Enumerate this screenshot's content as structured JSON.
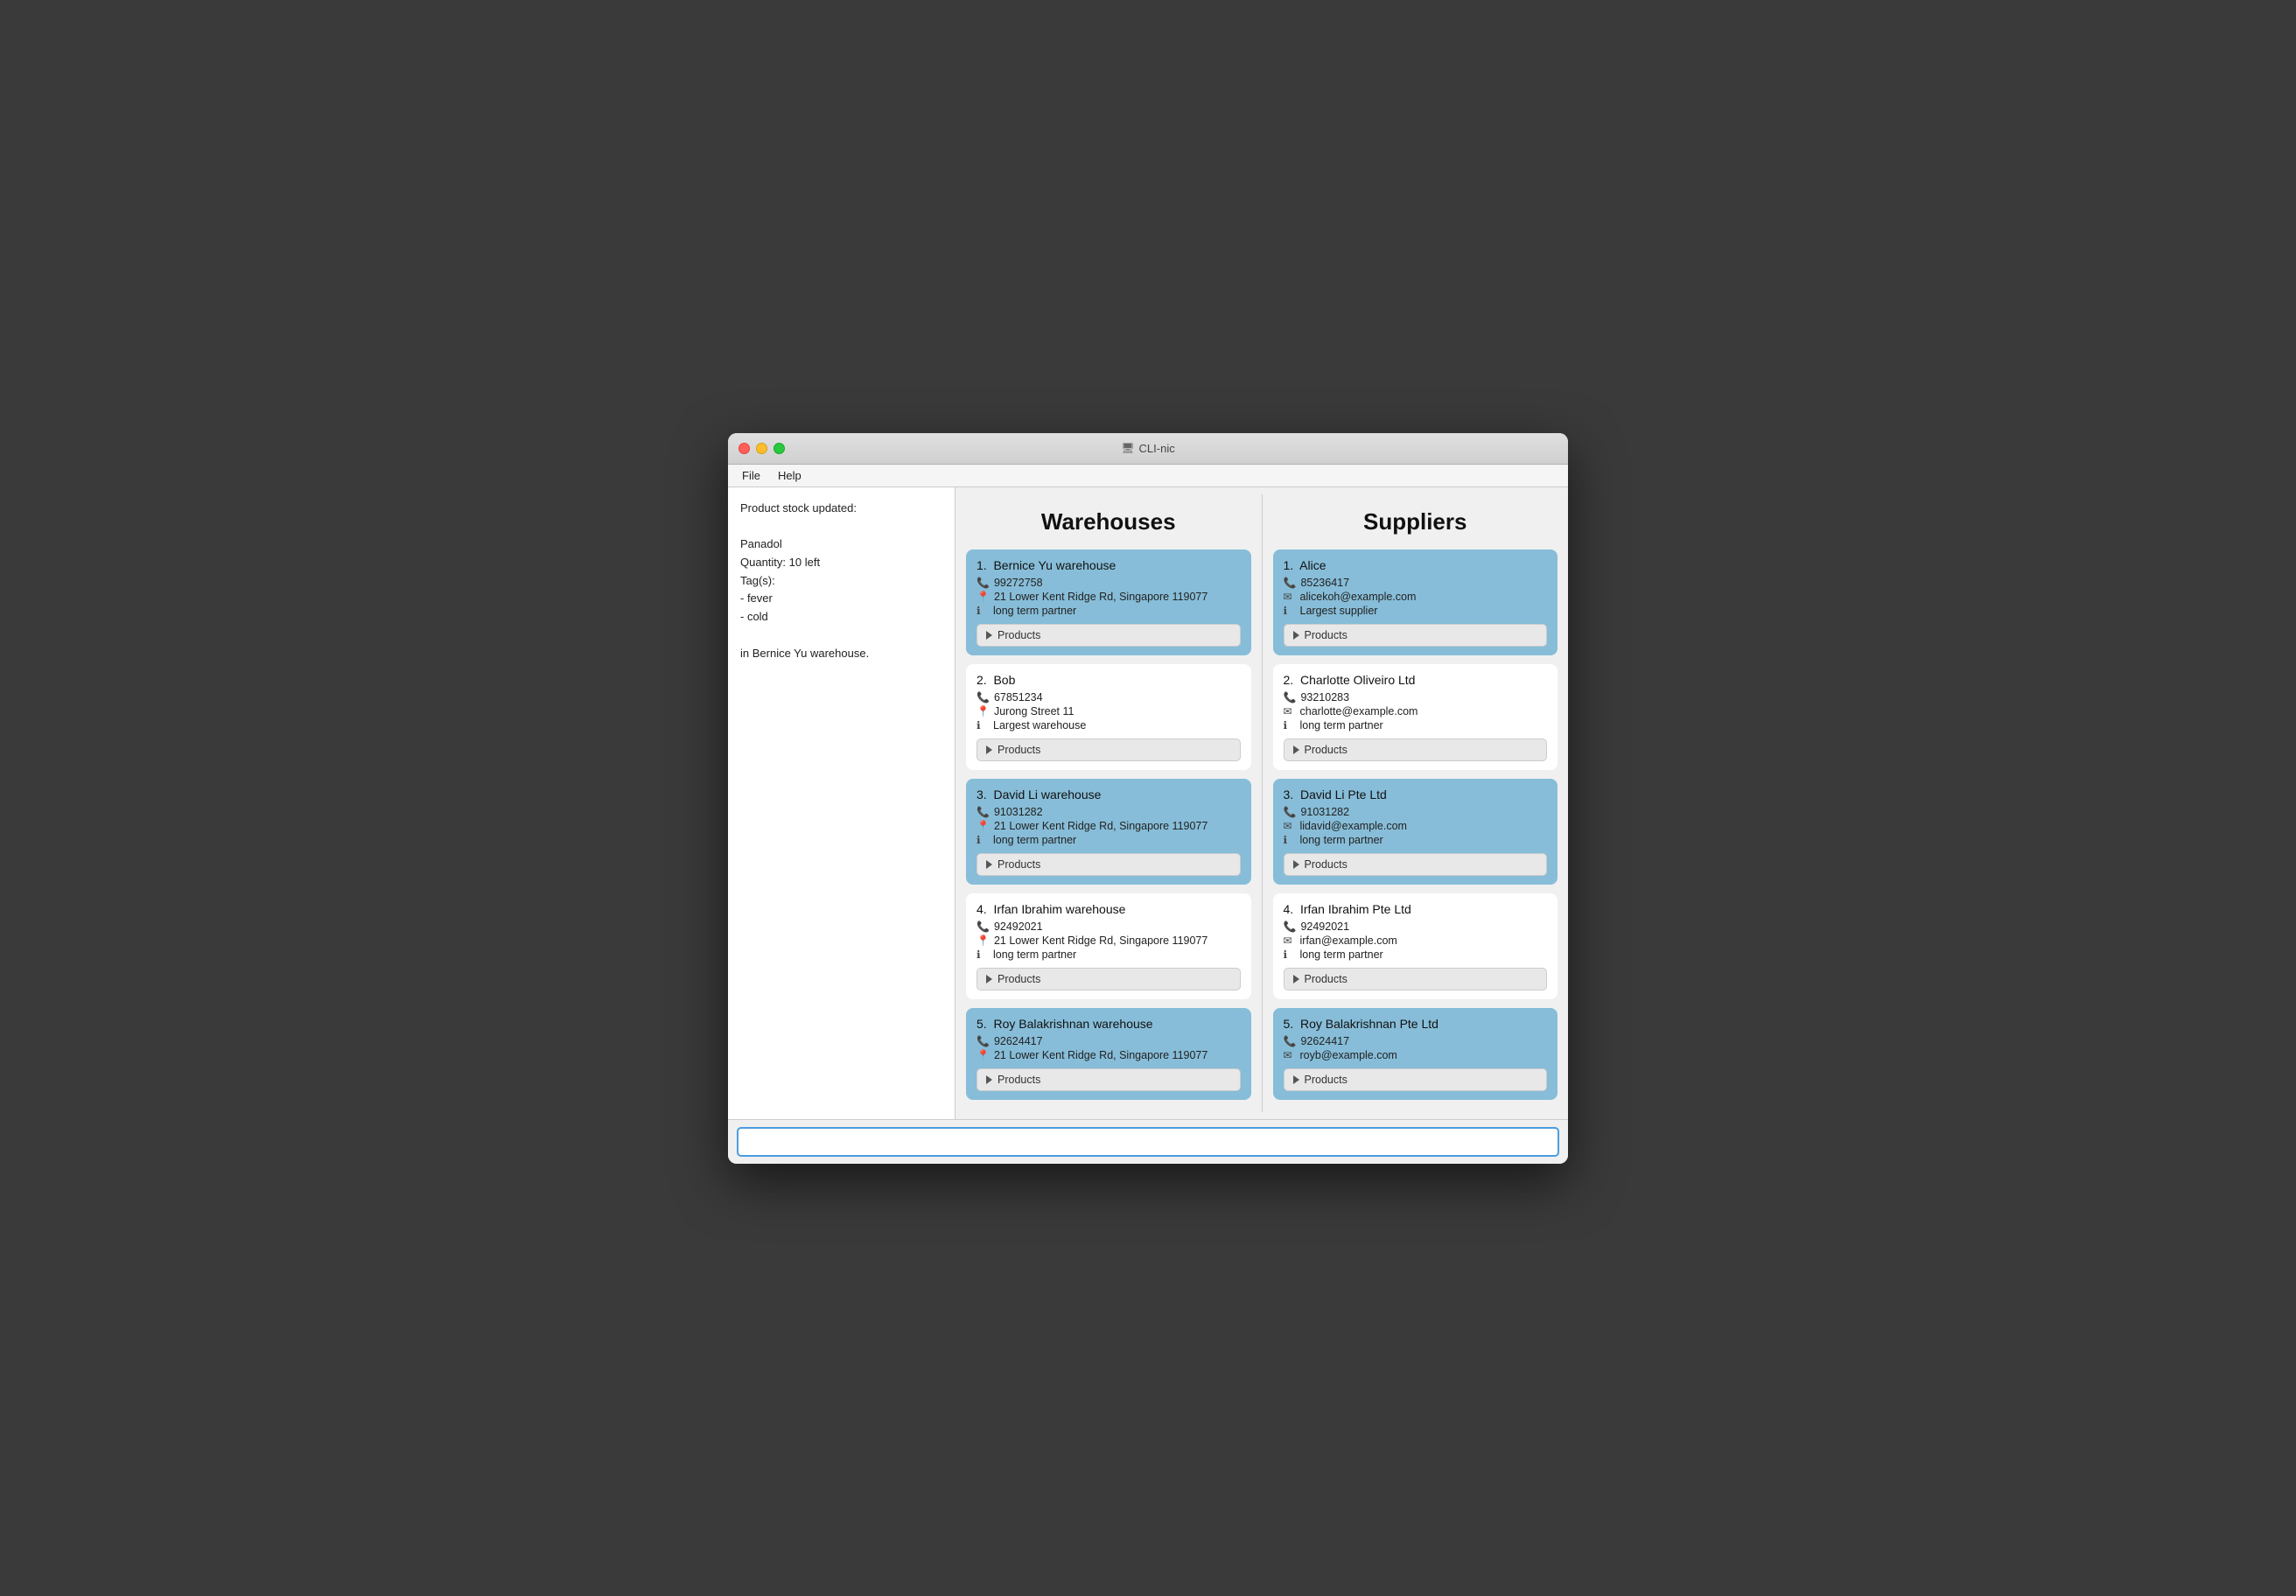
{
  "window": {
    "title": "CLI-nic",
    "title_icon": "🖥"
  },
  "menubar": {
    "items": [
      "File",
      "Help"
    ]
  },
  "left_panel": {
    "content": "Product stock updated:\n\nPanadol\nQuantity: 10 left\nTag(s):\n- fever\n- cold\n\nin Bernice Yu warehouse."
  },
  "warehouses": {
    "title": "Warehouses",
    "cards": [
      {
        "index": "1.",
        "name": "Bernice Yu warehouse",
        "phone": "99272758",
        "address": "21 Lower Kent Ridge Rd, Singapore 119077",
        "info": "long term partner",
        "highlighted": true
      },
      {
        "index": "2.",
        "name": "Bob",
        "phone": "67851234",
        "address": "Jurong Street 11",
        "info": "Largest warehouse",
        "highlighted": false
      },
      {
        "index": "3.",
        "name": "David Li warehouse",
        "phone": "91031282",
        "address": "21 Lower Kent Ridge Rd, Singapore 119077",
        "info": "long term partner",
        "highlighted": true
      },
      {
        "index": "4.",
        "name": "Irfan Ibrahim warehouse",
        "phone": "92492021",
        "address": "21 Lower Kent Ridge Rd, Singapore 119077",
        "info": "long term partner",
        "highlighted": false
      },
      {
        "index": "5.",
        "name": "Roy Balakrishnan warehouse",
        "phone": "92624417",
        "address": "21 Lower Kent Ridge Rd, Singapore 119077",
        "info": "",
        "highlighted": true
      }
    ],
    "products_label": "Products"
  },
  "suppliers": {
    "title": "Suppliers",
    "cards": [
      {
        "index": "1.",
        "name": "Alice",
        "phone": "85236417",
        "email": "alicekoh@example.com",
        "info": "Largest supplier",
        "highlighted": true
      },
      {
        "index": "2.",
        "name": "Charlotte Oliveiro Ltd",
        "phone": "93210283",
        "email": "charlotte@example.com",
        "info": "long term partner",
        "highlighted": false
      },
      {
        "index": "3.",
        "name": "David Li Pte Ltd",
        "phone": "91031282",
        "email": "lidavid@example.com",
        "info": "long term partner",
        "highlighted": true
      },
      {
        "index": "4.",
        "name": "Irfan Ibrahim Pte Ltd",
        "phone": "92492021",
        "email": "irfan@example.com",
        "info": "long term partner",
        "highlighted": false
      },
      {
        "index": "5.",
        "name": "Roy Balakrishnan Pte Ltd",
        "phone": "92624417",
        "email": "royb@example.com",
        "info": "",
        "highlighted": true
      }
    ],
    "products_label": "Products"
  },
  "command": {
    "placeholder": ""
  }
}
